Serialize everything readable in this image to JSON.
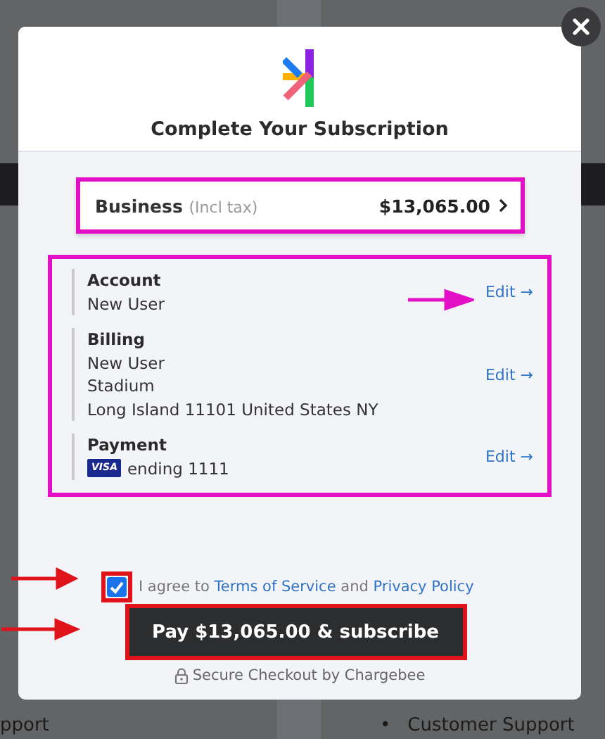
{
  "background": {
    "left_footer": "pport",
    "right_bullets": [
      {
        "marker": "•",
        "text": "Customer Support"
      }
    ]
  },
  "modal": {
    "title": "Complete Your Subscription",
    "plan": {
      "name": "Business",
      "note": "(Incl tax)",
      "price": "$13,065.00"
    },
    "sections": [
      {
        "kind": "text",
        "label": "Account",
        "lines": [
          "New User"
        ],
        "action": "Edit →"
      },
      {
        "kind": "text",
        "label": "Billing",
        "lines": [
          "New User",
          "Stadium",
          "Long Island 11101 United States NY"
        ],
        "action": "Edit →"
      },
      {
        "kind": "card",
        "label": "Payment",
        "card_brand": "VISA",
        "lines": [
          "ending 1111"
        ],
        "action": "Edit →"
      }
    ],
    "consent": {
      "checked": true,
      "text_before": "I agree to",
      "terms": "Terms of Service",
      "joiner": "and",
      "privacy": "Privacy Policy"
    },
    "pay_button": "Pay $13,065.00 & subscribe",
    "footer": "Secure Checkout by Chargebee"
  }
}
